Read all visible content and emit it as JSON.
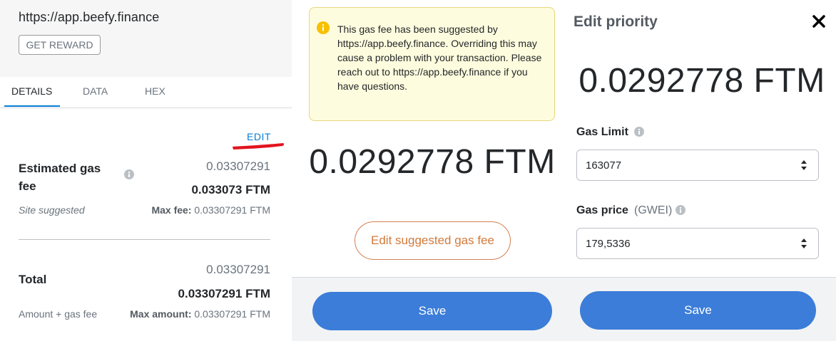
{
  "confirm": {
    "origin": "https://app.beefy.finance",
    "method_button": "GET REWARD",
    "tabs": [
      "DETAILS",
      "DATA",
      "HEX"
    ],
    "edit_label": "EDIT",
    "gas": {
      "title": "Estimated gas fee",
      "secondary_amount": "0.03307291",
      "primary_amount": "0.033073 FTM",
      "site_suggested": "Site suggested",
      "max_fee_label": "Max fee:",
      "max_fee_value": "0.03307291 FTM"
    },
    "total": {
      "title": "Total",
      "secondary_amount": "0.03307291",
      "primary_amount": "0.03307291 FTM",
      "subtitle": "Amount + gas fee",
      "max_amount_label": "Max amount:",
      "max_amount_value": "0.03307291 FTM"
    }
  },
  "edit_gas": {
    "warning": "This gas fee has been suggested by https://app.beefy.finance. Overriding this may cause a problem with your transaction. Please reach out to https://app.beefy.finance if you have questions.",
    "amount": "0.0292778 FTM",
    "edit_suggested_button": "Edit suggested gas fee",
    "save_button": "Save"
  },
  "edit_priority": {
    "title": "Edit priority",
    "amount": "0.0292778 FTM",
    "gas_limit_label": "Gas Limit",
    "gas_limit_value": "163077",
    "gas_price_label": "Gas price",
    "gas_price_unit": "(GWEI)",
    "gas_price_value": "179,5336",
    "save_button": "Save"
  },
  "colors": {
    "accent_blue": "#037dd6",
    "save_button_blue": "#3b7dd8",
    "warning_bg": "#fefcde",
    "warning_icon": "#f8c000",
    "edit_button_orange": "#d17a3b",
    "annotation_red": "#e2141d"
  },
  "icons": [
    "info-icon",
    "warning-icon",
    "close-icon",
    "stepper-icon"
  ]
}
